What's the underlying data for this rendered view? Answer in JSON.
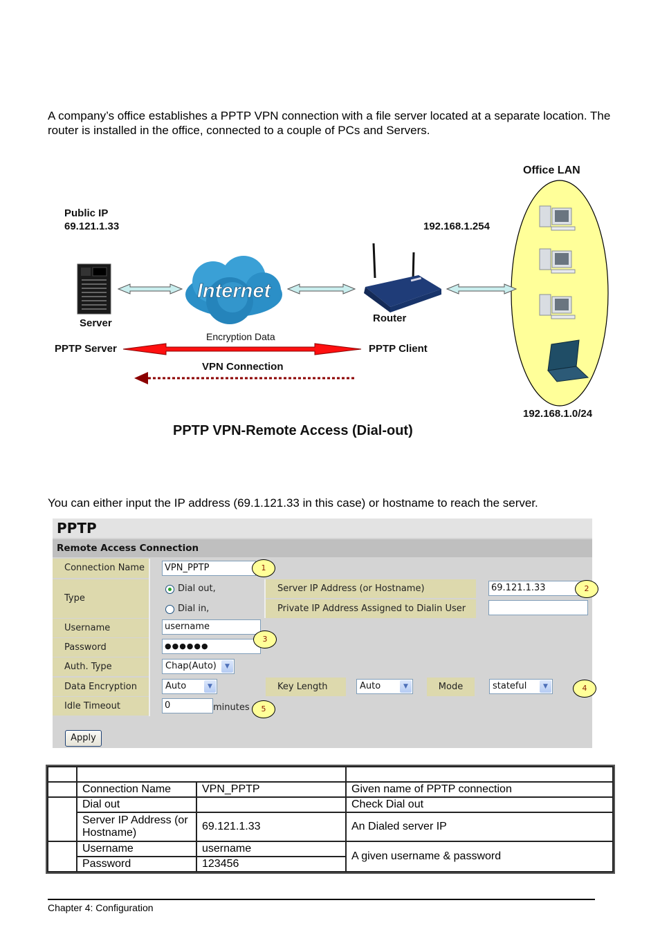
{
  "intro_text": "A company’s office establishes a PPTP VPN connection with a file server located at a separate location. The router is installed in the office, connected to a couple of PCs and Servers.",
  "diagram": {
    "public_ip_label": "Public IP",
    "public_ip": "69.121.1.33",
    "server_label": "Server",
    "pptp_server_label": "PPTP Server",
    "internet_label": "Internet",
    "encryption_label": "Encryption Data",
    "vpn_connection_label": "VPN Connection",
    "router_ip": "192.168.1.254",
    "router_label": "Router",
    "pptp_client_label": "PPTP Client",
    "office_lan_label": "Office LAN",
    "lan_subnet": "192.168.1.0/24",
    "title": "PPTP VPN-Remote Access (Dial-out)",
    "colors": {
      "lan_ellipse": "#ffff99",
      "encryption_arrow": "#ff0000",
      "vpn_arrow": "#8b0000",
      "link_arrow": "#c9eeee",
      "cloud": "#2b8fc7"
    }
  },
  "lead_text": "You can either input the IP address (69.1.121.33 in this case) or hostname to reach the server.",
  "form": {
    "title": "PPTP",
    "section": "Remote Access Connection",
    "connection_name_label": "Connection Name",
    "connection_name_value": "VPN_PPTP",
    "type_label": "Type",
    "dial_out_label": "Dial out,",
    "dial_in_label": "Dial in,",
    "dial_out_selected": true,
    "server_ip_label": "Server IP Address (or Hostname)",
    "server_ip_value": "69.121.1.33",
    "private_ip_label": "Private IP Address Assigned to Dialin User",
    "private_ip_value": "",
    "username_label": "Username",
    "username_value": "username",
    "password_label": "Password",
    "password_mask": "●●●●●●",
    "auth_type_label": "Auth. Type",
    "auth_type_value": "Chap(Auto)",
    "data_encryption_label": "Data Encryption",
    "data_encryption_value": "Auto",
    "key_length_label": "Key Length",
    "key_length_value": "Auto",
    "mode_label": "Mode",
    "mode_value": "stateful",
    "idle_timeout_label": "Idle Timeout",
    "idle_timeout_value": "0",
    "idle_timeout_unit": "minutes",
    "apply_label": "Apply",
    "callouts": [
      "1",
      "2",
      "3",
      "4",
      "5"
    ],
    "dropdown_arrow": "▼"
  },
  "summary_table": {
    "header": [
      "",
      "",
      ""
    ],
    "rows": [
      {
        "num": "",
        "field": "Connection Name",
        "value": "VPN_PPTP",
        "desc": "Given name of PPTP connection"
      },
      {
        "num": "",
        "field": "Dial out",
        "value": "",
        "desc": "Check Dial out"
      },
      {
        "num": "",
        "field": "Server IP Address (or Hostname)",
        "value": "69.121.1.33",
        "desc": "An Dialed server IP"
      },
      {
        "num": "",
        "field": "Username",
        "value": "username",
        "desc": "A given username & password"
      },
      {
        "num": "",
        "field": "Password",
        "value": "123456",
        "desc": ""
      }
    ]
  },
  "footer": {
    "chapter": "Chapter 4: Configuration"
  }
}
